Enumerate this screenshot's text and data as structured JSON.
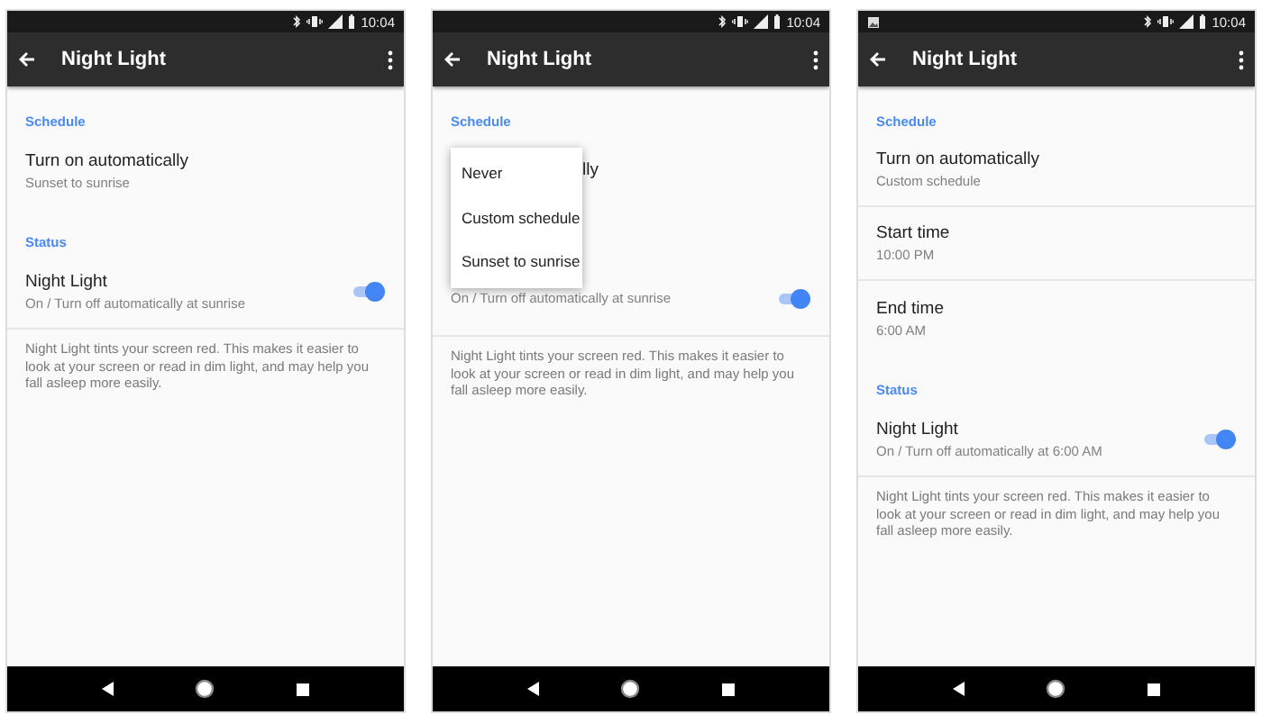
{
  "screens": [
    {
      "status_bar": {
        "time": "10:04",
        "notification": false
      },
      "toolbar": {
        "title": "Night Light"
      },
      "items": [
        {
          "kind": "header",
          "text": "Schedule"
        },
        {
          "kind": "setting",
          "title": "Turn on automatically",
          "subtitle": "Sunset to sunrise"
        },
        {
          "kind": "header",
          "text": "Status"
        },
        {
          "kind": "toggle",
          "title": "Night Light",
          "subtitle": "On / Turn off automatically at sunrise",
          "on": true
        },
        {
          "kind": "note",
          "text": "Night Light tints your screen red. This makes it easier to look at your screen or read in dim light, and may help you fall asleep more easily."
        }
      ]
    },
    {
      "status_bar": {
        "time": "10:04",
        "notification": false
      },
      "toolbar": {
        "title": "Night Light"
      },
      "items": [
        {
          "kind": "header",
          "text": "Schedule"
        },
        {
          "kind": "setting",
          "title": "lly"
        },
        {
          "kind": "spacer"
        },
        {
          "kind": "toggle",
          "subtitle": "On / Turn off automatically at sunrise",
          "on": true
        },
        {
          "kind": "note",
          "text": "Night Light tints your screen red. This makes it easier to look at your screen or read in dim light, and may help you fall asleep more easily."
        }
      ],
      "menu": {
        "options": [
          "Never",
          "Custom schedule",
          "Sunset to sunrise"
        ]
      }
    },
    {
      "status_bar": {
        "time": "10:04",
        "notification": true
      },
      "toolbar": {
        "title": "Night Light"
      },
      "items": [
        {
          "kind": "header",
          "text": "Schedule"
        },
        {
          "kind": "setting",
          "title": "Turn on automatically",
          "subtitle": "Custom schedule"
        },
        {
          "kind": "setting",
          "title": "Start time",
          "subtitle": "10:00 PM"
        },
        {
          "kind": "setting",
          "title": "End time",
          "subtitle": "6:00 AM"
        },
        {
          "kind": "header",
          "text": "Status"
        },
        {
          "kind": "toggle",
          "title": "Night Light",
          "subtitle": "On / Turn off automatically at 6:00 AM",
          "on": true
        },
        {
          "kind": "note",
          "text": "Night Light tints your screen red. This makes it easier to look at your screen or read in dim light, and may help you fall asleep more easily."
        }
      ]
    }
  ]
}
